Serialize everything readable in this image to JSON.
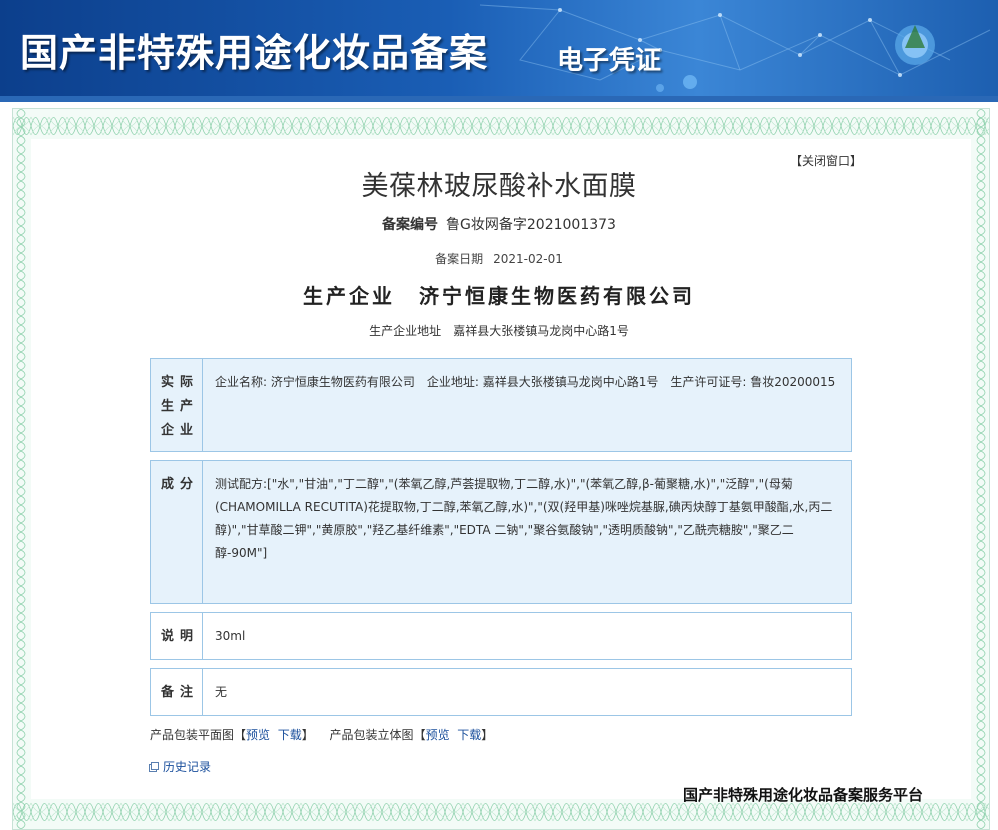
{
  "header": {
    "title": "国产非特殊用途化妆品备案",
    "subtitle": "电子凭证"
  },
  "actions": {
    "close_window": "【关闭窗口】"
  },
  "product": {
    "name": "美葆林玻尿酸补水面膜",
    "reg_no_label": "备案编号",
    "reg_no": "鲁G妆网备字2021001373",
    "reg_date_label": "备案日期",
    "reg_date": "2021-02-01",
    "producer_label": "生产企业",
    "producer": "济宁恒康生物医药有限公司",
    "producer_addr_label": "生产企业地址",
    "producer_addr": "嘉祥县大张楼镇马龙岗中心路1号"
  },
  "sections": {
    "actual_producer": {
      "label": "实际生产企业",
      "value": "企业名称: 济宁恒康生物医药有限公司　企业地址: 嘉祥县大张楼镇马龙岗中心路1号　生产许可证号: 鲁妆20200015"
    },
    "ingredients": {
      "label": "成分",
      "value": "测试配方:[\"水\",\"甘油\",\"丁二醇\",\"(苯氧乙醇,芦荟提取物,丁二醇,水)\",\"(苯氧乙醇,β-葡聚糖,水)\",\"泛醇\",\"(母菊(CHAMOMILLA RECUTITA)花提取物,丁二醇,苯氧乙醇,水)\",\"(双(羟甲基)咪唑烷基脲,碘丙炔醇丁基氨甲酸酯,水,丙二醇)\",\"甘草酸二钾\",\"黄原胶\",\"羟乙基纤维素\",\"EDTA 二钠\",\"聚谷氨酸钠\",\"透明质酸钠\",\"乙酰壳糖胺\",\"聚乙二醇-90M\"]"
    },
    "description": {
      "label": "说明",
      "value": "30ml"
    },
    "remark": {
      "label": "备注",
      "value": "无"
    }
  },
  "packaging": {
    "flat_label": "产品包装平面图",
    "stereo_label": "产品包装立体图",
    "bracket_open": "【",
    "bracket_close": "】",
    "preview": "预览",
    "download": "下载"
  },
  "history": {
    "label": "历史记录"
  },
  "footer": {
    "platform": "国产非特殊用途化妆品备案服务平台"
  },
  "colors": {
    "banner": "#1a5eb5",
    "box_border": "#9cc6e6",
    "box_fill": "#e6f2fb",
    "link": "#1a4f9c"
  }
}
